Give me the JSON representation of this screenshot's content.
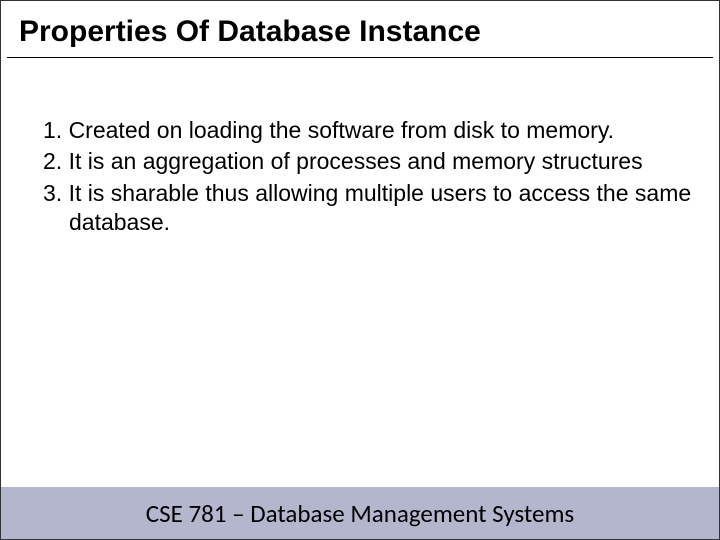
{
  "slide": {
    "title": "Properties Of Database Instance",
    "items": [
      "1. Created on loading the software from disk to memory.",
      "2. It is an aggregation of processes and memory structures",
      "3. It is sharable thus allowing multiple users to access the same database."
    ],
    "footer": "CSE 781 – Database Management Systems"
  }
}
